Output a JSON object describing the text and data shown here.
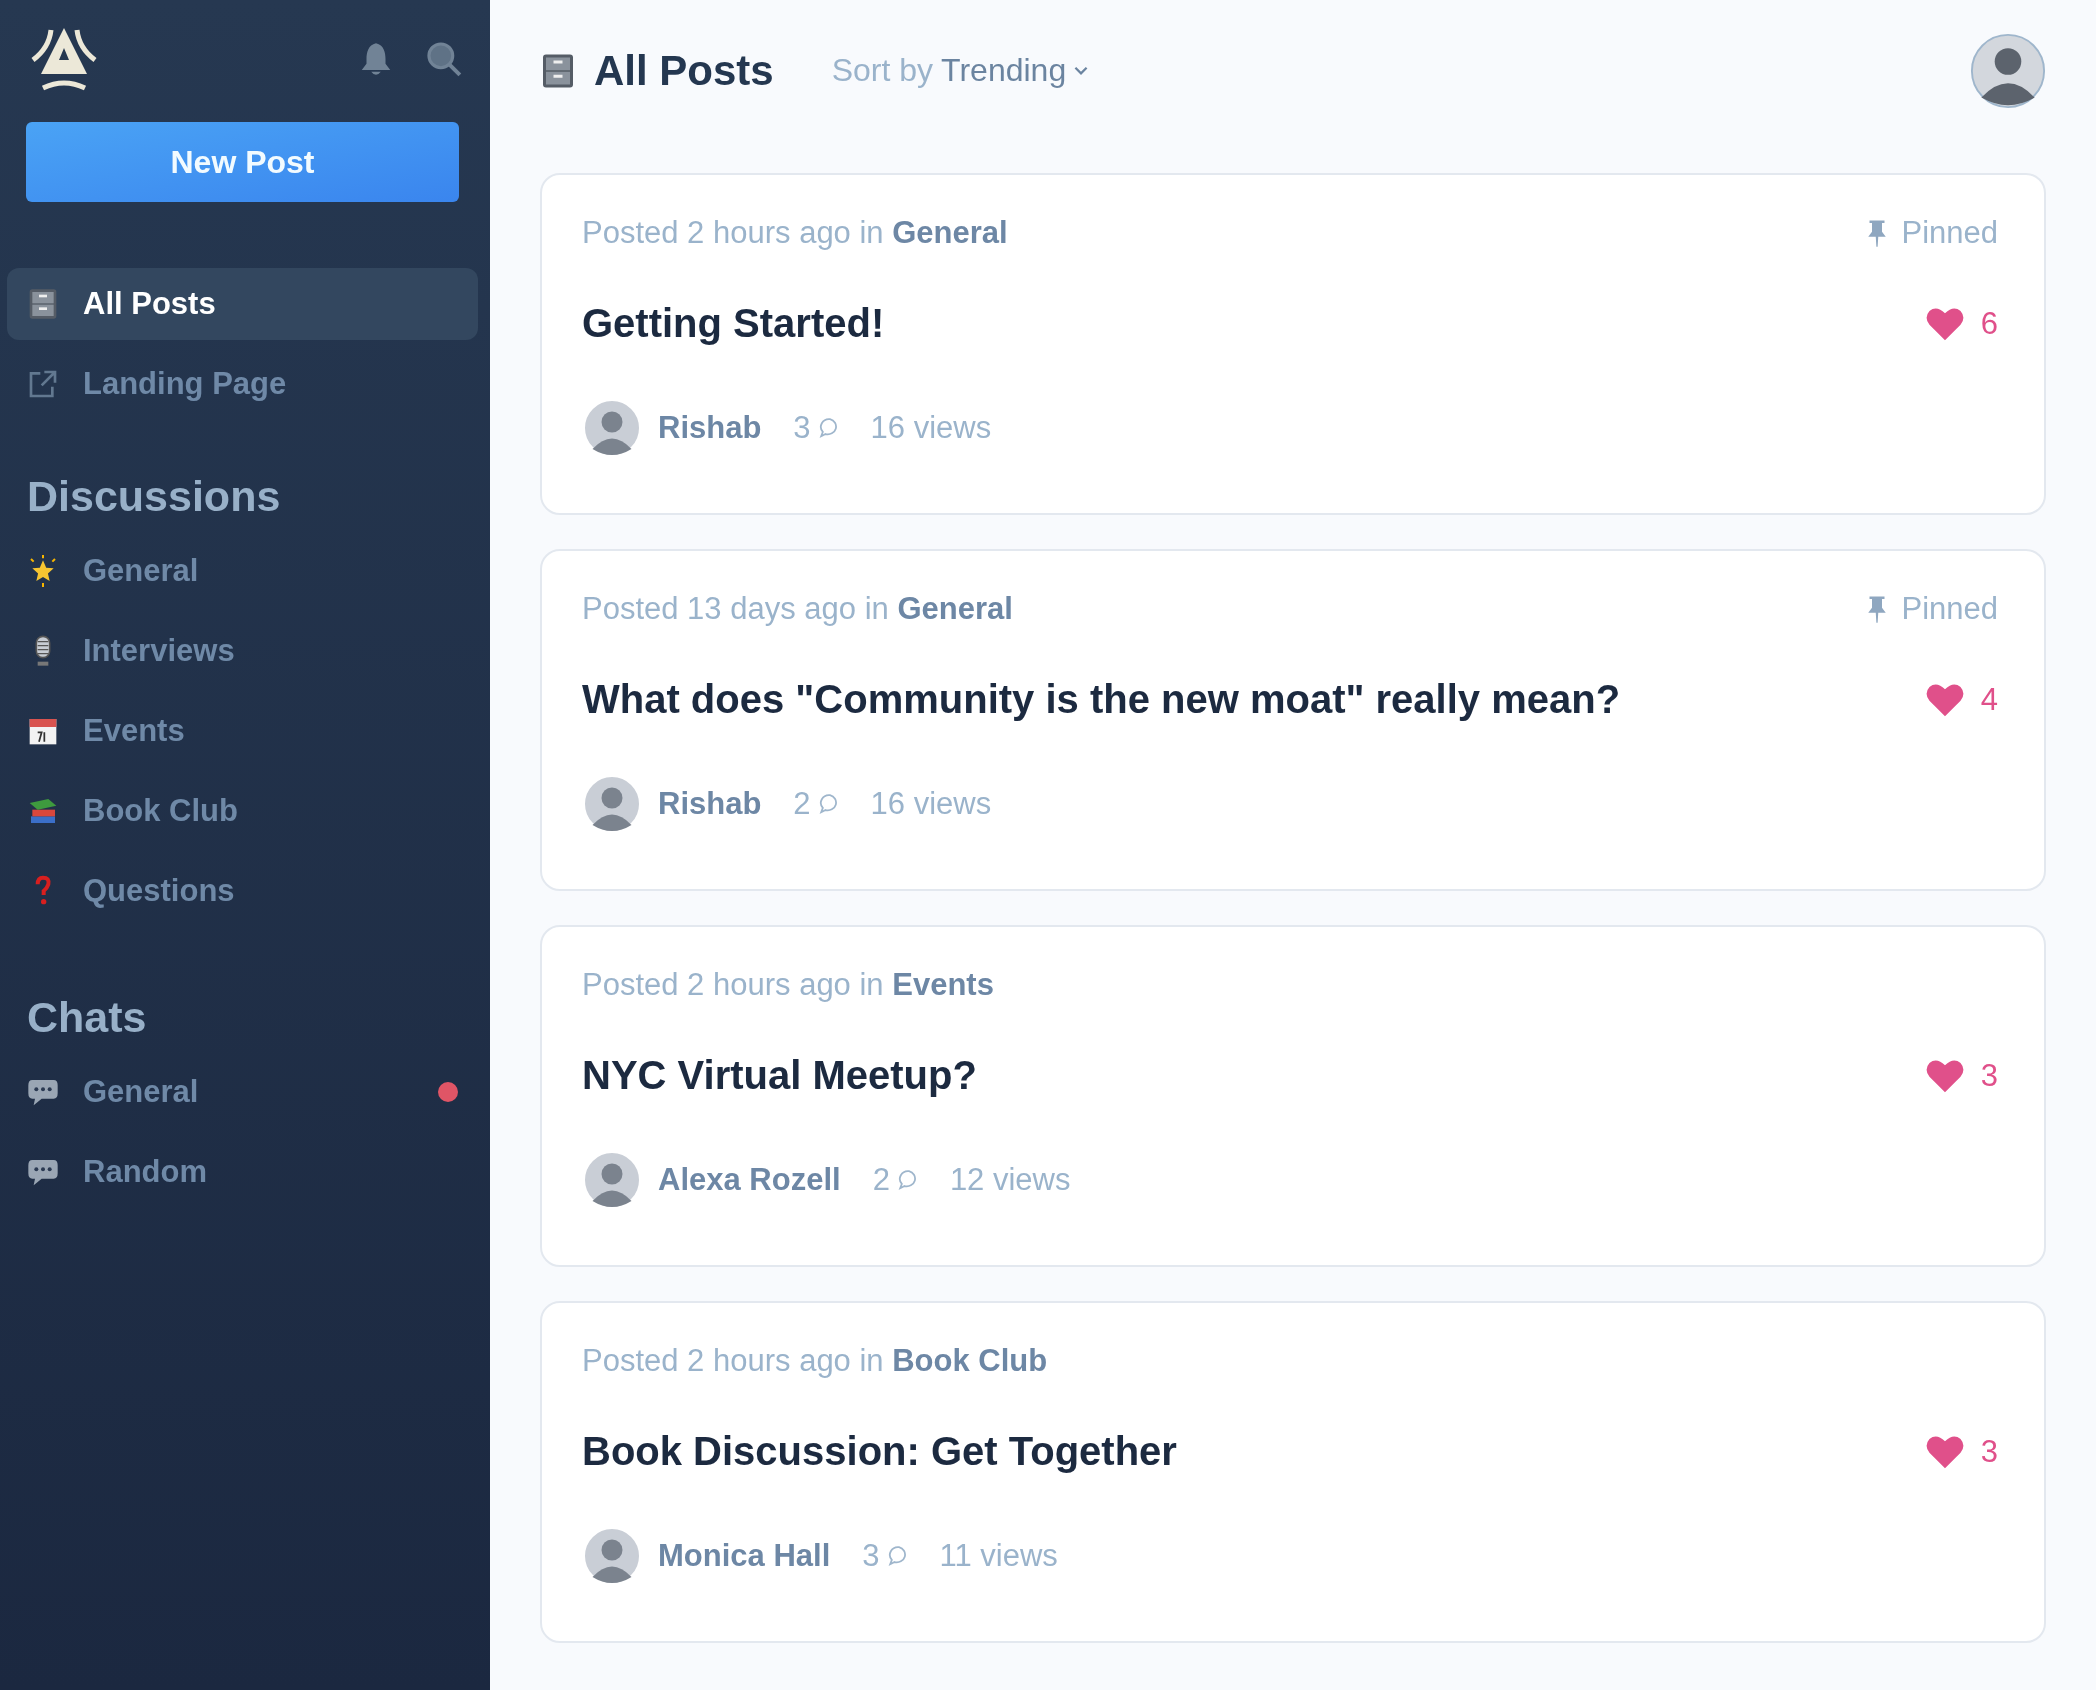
{
  "sidebar": {
    "new_post_button": "New Post",
    "nav": [
      {
        "label": "All Posts",
        "selected": true
      },
      {
        "label": "Landing Page",
        "selected": false
      }
    ],
    "discussions": {
      "title": "Discussions",
      "items": [
        {
          "label": "General",
          "selected": false
        },
        {
          "label": "Interviews",
          "selected": false
        },
        {
          "label": "Events",
          "selected": false
        },
        {
          "label": "Book Club",
          "selected": false
        },
        {
          "label": "Questions",
          "selected": false
        }
      ]
    },
    "chats": {
      "title": "Chats",
      "items": [
        {
          "label": "General",
          "unread": true
        },
        {
          "label": "Random",
          "unread": false
        }
      ]
    }
  },
  "header": {
    "title": "All Posts",
    "sort_label": "Sort by",
    "sort_value": "Trending"
  },
  "posts": [
    {
      "meta": "Posted 2 hours ago in **General**",
      "pinned": "Pinned",
      "title": "Getting Started!",
      "likes": "6",
      "author": "Rishab",
      "comments": "3",
      "views": "16 views"
    },
    {
      "meta": "Posted 13 days ago in **General**",
      "pinned": "Pinned",
      "title": "What does \"Community is the new moat\" really mean?",
      "likes": "4",
      "author": "Rishab",
      "comments": "2",
      "views": "16 views"
    },
    {
      "meta": "Posted 2 hours ago in **Events**",
      "title": "NYC Virtual Meetup?",
      "likes": "3",
      "author": "Alexa Rozell",
      "comments": "2",
      "views": "12 views"
    },
    {
      "meta": "Posted 2 hours ago in **Book Club**",
      "title": "Book Discussion: Get Together",
      "likes": "3",
      "author": "Monica Hall",
      "comments": "3",
      "views": "11 views"
    }
  ]
}
